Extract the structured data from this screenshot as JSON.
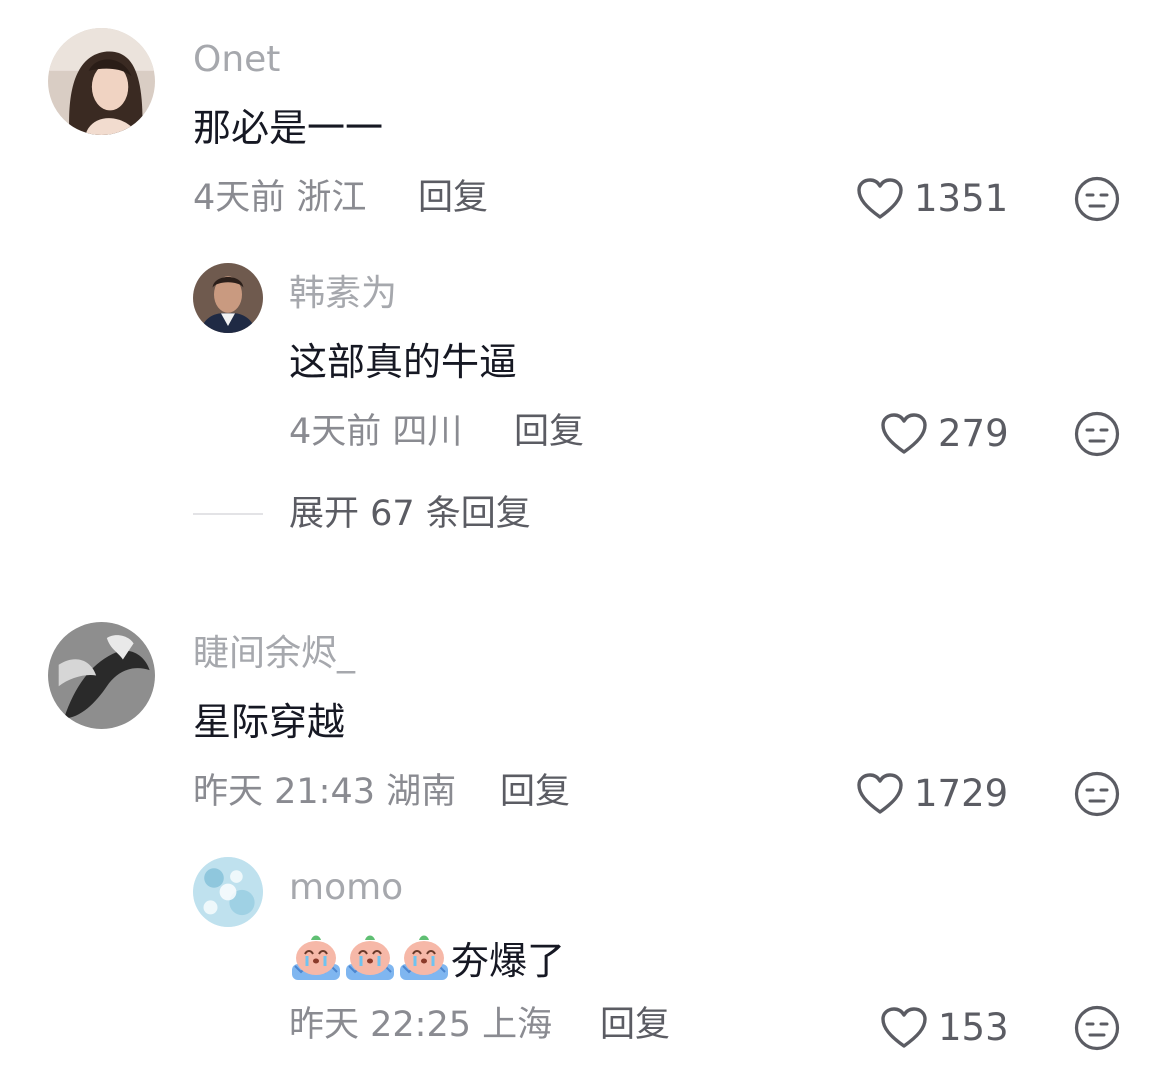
{
  "comments": [
    {
      "username": "Onet",
      "text": "那必是一一",
      "time": "4天前",
      "location": "浙江",
      "reply_label": "回复",
      "likes": "1351",
      "avatar_icon": "woman-photo-avatar",
      "replies": [
        {
          "username": "韩素为",
          "text": "这部真的牛逼",
          "time": "4天前",
          "location": "四川",
          "reply_label": "回复",
          "likes": "279",
          "avatar_icon": "man-photo-avatar"
        }
      ],
      "expand_label": "展开 67 条回复"
    },
    {
      "username": "睫间余烬_",
      "text": "星际穿越",
      "time": "昨天 21:43",
      "location": "湖南",
      "reply_label": "回复",
      "likes": "1729",
      "avatar_icon": "bw-hand-photo-avatar",
      "replies": [
        {
          "username": "momo",
          "text_emojis": [
            "crying-peach-emoji",
            "crying-peach-emoji",
            "crying-peach-emoji"
          ],
          "text": "夯爆了",
          "time": "昨天 22:25",
          "location": "上海",
          "reply_label": "回复",
          "likes": "153",
          "avatar_icon": "blue-floral-avatar"
        }
      ]
    }
  ],
  "colors": {
    "username": "#a6a8ad",
    "text": "#161823",
    "meta": "#8a8b91",
    "action": "#5b5c63"
  }
}
